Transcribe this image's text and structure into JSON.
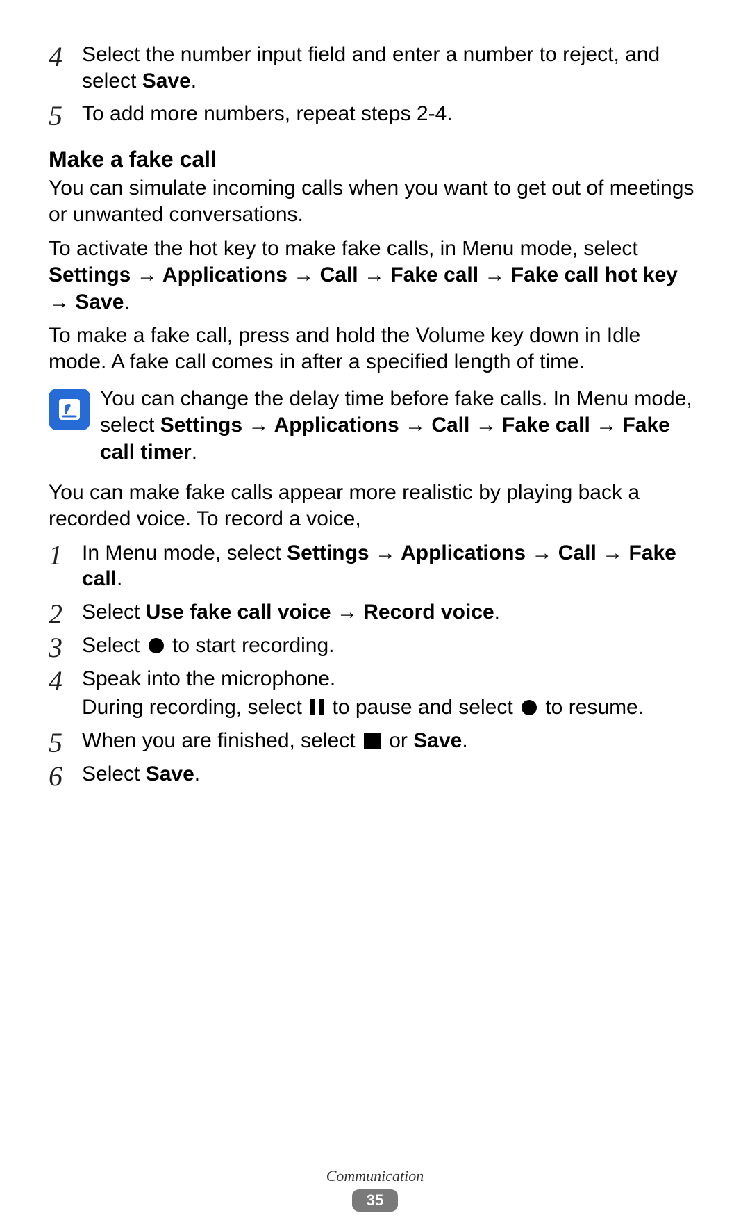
{
  "topSteps": [
    {
      "num": "4",
      "paras": [
        {
          "runs": [
            {
              "t": "Select the number input field and enter a number to reject, and select "
            },
            {
              "t": "Save",
              "b": true
            },
            {
              "t": "."
            }
          ]
        }
      ]
    },
    {
      "num": "5",
      "paras": [
        {
          "runs": [
            {
              "t": "To add more numbers, repeat steps 2-4."
            }
          ]
        }
      ]
    }
  ],
  "sectionTitle": "Make a fake call",
  "paragraphs": [
    {
      "runs": [
        {
          "t": "You can simulate incoming calls when you want to get out of meetings or unwanted conversations."
        }
      ]
    },
    {
      "runs": [
        {
          "t": "To activate the hot key to make fake calls, in Menu mode, select "
        },
        {
          "t": "Settings",
          "b": true
        },
        {
          "t": " → ",
          "b": true
        },
        {
          "t": "Applications",
          "b": true
        },
        {
          "t": " → ",
          "b": true
        },
        {
          "t": "Call",
          "b": true
        },
        {
          "t": " → ",
          "b": true
        },
        {
          "t": "Fake call",
          "b": true
        },
        {
          "t": " → ",
          "b": true
        },
        {
          "t": "Fake call hot key",
          "b": true
        },
        {
          "t": " → ",
          "b": true
        },
        {
          "t": "Save",
          "b": true
        },
        {
          "t": "."
        }
      ]
    },
    {
      "runs": [
        {
          "t": "To make a fake call, press and hold the Volume key down in Idle mode. A fake call comes in after a specified length of time."
        }
      ]
    }
  ],
  "note": {
    "runs": [
      {
        "t": "You can change the delay time before fake calls. In Menu mode, select "
      },
      {
        "t": "Settings",
        "b": true
      },
      {
        "t": " → ",
        "b": true
      },
      {
        "t": "Applications",
        "b": true
      },
      {
        "t": " → ",
        "b": true
      },
      {
        "t": "Call",
        "b": true
      },
      {
        "t": " → ",
        "b": true
      },
      {
        "t": "Fake call",
        "b": true
      },
      {
        "t": " → ",
        "b": true
      },
      {
        "t": "Fake call timer",
        "b": true
      },
      {
        "t": "."
      }
    ]
  },
  "afterNote": {
    "runs": [
      {
        "t": "You can make fake calls appear more realistic by playing back a recorded voice. To record a voice,"
      }
    ]
  },
  "steps": [
    {
      "num": "1",
      "paras": [
        {
          "runs": [
            {
              "t": "In Menu mode, select "
            },
            {
              "t": "Settings",
              "b": true
            },
            {
              "t": " → ",
              "b": true
            },
            {
              "t": "Applications",
              "b": true
            },
            {
              "t": " → ",
              "b": true
            },
            {
              "t": "Call",
              "b": true
            },
            {
              "t": " → ",
              "b": true
            },
            {
              "t": "Fake call",
              "b": true
            },
            {
              "t": "."
            }
          ]
        }
      ]
    },
    {
      "num": "2",
      "paras": [
        {
          "runs": [
            {
              "t": "Select "
            },
            {
              "t": "Use fake call voice",
              "b": true
            },
            {
              "t": " → ",
              "b": true
            },
            {
              "t": "Record voice",
              "b": true
            },
            {
              "t": "."
            }
          ]
        }
      ]
    },
    {
      "num": "3",
      "paras": [
        {
          "runs": [
            {
              "t": "Select "
            },
            {
              "glyph": "record"
            },
            {
              "t": " to start recording."
            }
          ]
        }
      ]
    },
    {
      "num": "4",
      "paras": [
        {
          "runs": [
            {
              "t": "Speak into the microphone."
            }
          ]
        },
        {
          "runs": [
            {
              "t": "During recording, select "
            },
            {
              "glyph": "pause"
            },
            {
              "t": " to pause and select "
            },
            {
              "glyph": "record"
            },
            {
              "t": " to resume."
            }
          ]
        }
      ]
    },
    {
      "num": "5",
      "paras": [
        {
          "runs": [
            {
              "t": "When you are finished, select "
            },
            {
              "glyph": "stop"
            },
            {
              "t": " or "
            },
            {
              "t": "Save",
              "b": true
            },
            {
              "t": "."
            }
          ]
        }
      ]
    },
    {
      "num": "6",
      "paras": [
        {
          "runs": [
            {
              "t": "Select "
            },
            {
              "t": "Save",
              "b": true
            },
            {
              "t": "."
            }
          ]
        }
      ]
    }
  ],
  "footer": {
    "section": "Communication",
    "page": "35"
  }
}
